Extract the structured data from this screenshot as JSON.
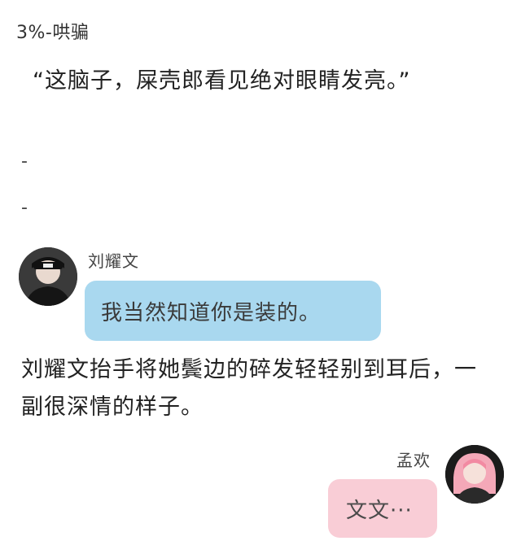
{
  "chapter": {
    "title": "3%-哄骗"
  },
  "narration": {
    "line1": "“这脑子，屎壳郎看见绝对眼睛发亮。”",
    "separator1": "-",
    "separator2": "-",
    "line2": "刘耀文抬手将她鬓边的碎发轻轻别到耳后，一副很深情的样子。"
  },
  "messages": [
    {
      "sender": "刘耀文",
      "text": "我当然知道你是装的。",
      "side": "left",
      "bubble_color": "#a9d8ef"
    },
    {
      "sender": "孟欢",
      "text": "文文···",
      "side": "right",
      "bubble_color": "#f9cdd6"
    }
  ]
}
